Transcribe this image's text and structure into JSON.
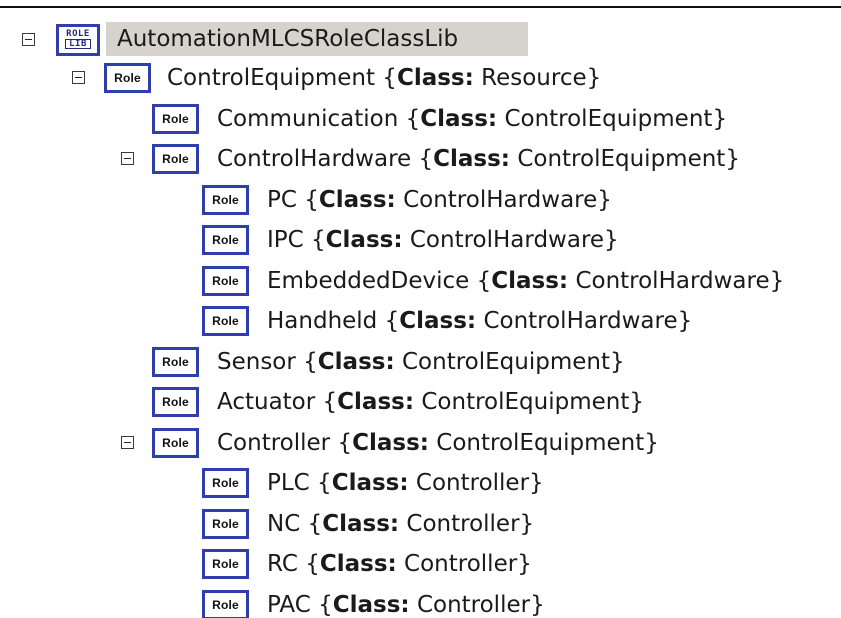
{
  "root": {
    "icon": "role-class-library-icon",
    "icon_text_top": "ROLE",
    "icon_text_bottom": "LIB",
    "label": "AutomationMLCSRoleClassLib",
    "expanded": true
  },
  "role_icon_text": "Role",
  "class_keyword": "Class:",
  "nodes": [
    {
      "name": "ControlEquipment",
      "cls": "Resource",
      "expanded": true
    },
    {
      "name": "Communication",
      "cls": "ControlEquipment"
    },
    {
      "name": "ControlHardware",
      "cls": "ControlEquipment",
      "expanded": true
    },
    {
      "name": "PC",
      "cls": "ControlHardware"
    },
    {
      "name": "IPC",
      "cls": "ControlHardware"
    },
    {
      "name": "EmbeddedDevice",
      "cls": "ControlHardware"
    },
    {
      "name": "Handheld",
      "cls": "ControlHardware"
    },
    {
      "name": "Sensor",
      "cls": "ControlEquipment"
    },
    {
      "name": "Actuator",
      "cls": "ControlEquipment"
    },
    {
      "name": "Controller",
      "cls": "ControlEquipment",
      "expanded": true
    },
    {
      "name": "PLC",
      "cls": "Controller"
    },
    {
      "name": "NC",
      "cls": "Controller"
    },
    {
      "name": "RC",
      "cls": "Controller"
    },
    {
      "name": "PAC",
      "cls": "Controller"
    }
  ]
}
